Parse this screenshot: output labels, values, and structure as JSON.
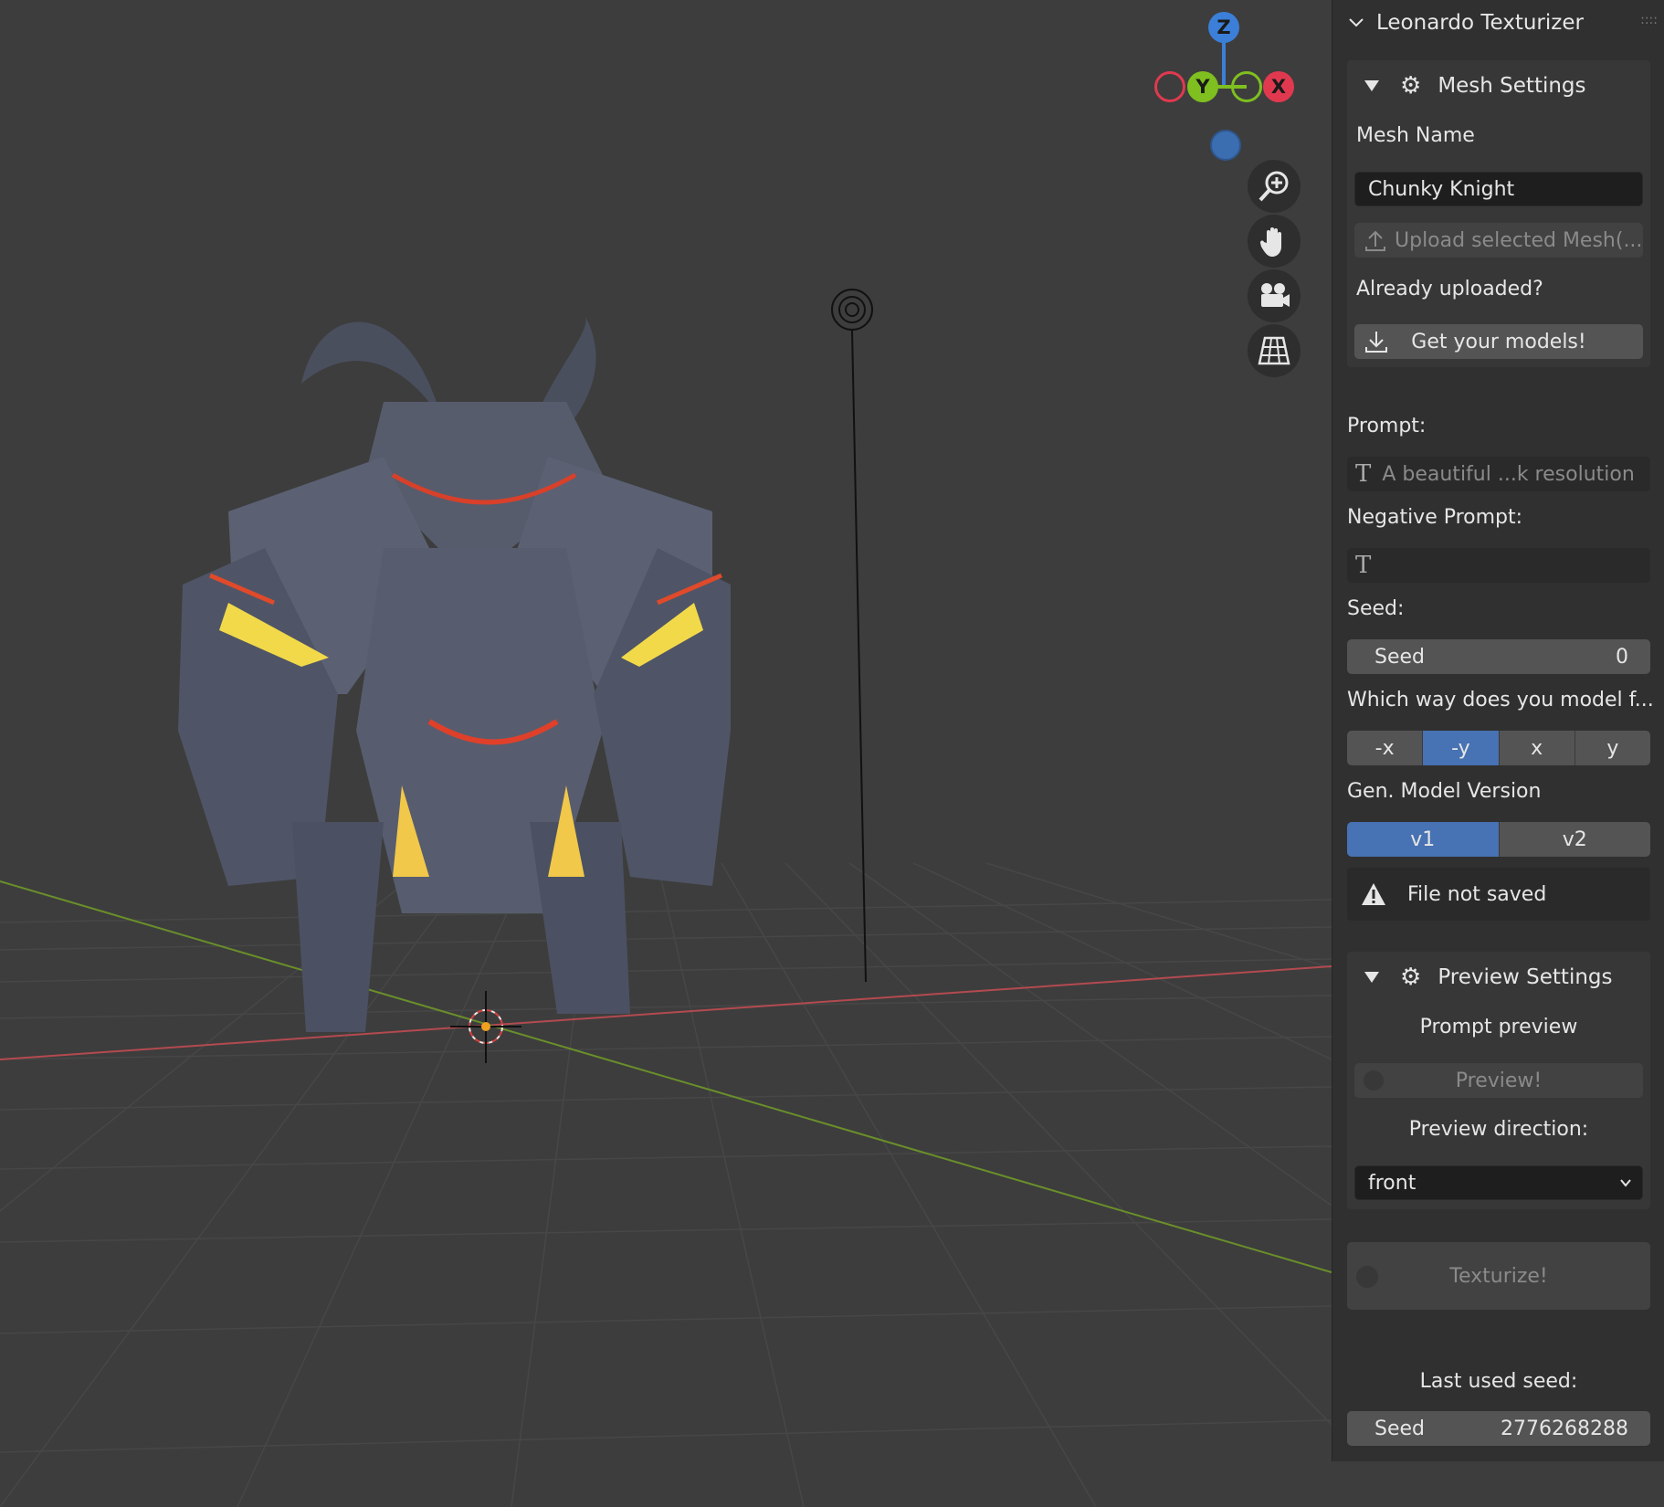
{
  "gizmo": {
    "z": "Z",
    "y": "Y",
    "x": "X"
  },
  "panel": {
    "title": "Leonardo Texturizer",
    "mesh_settings": {
      "title": "Mesh Settings",
      "mesh_name_label": "Mesh Name",
      "mesh_name_value": "Chunky Knight",
      "upload_button": "Upload selected Mesh(...",
      "already_uploaded_label": "Already uploaded?",
      "get_models_button": "Get your models!"
    },
    "prompt_label": "Prompt:",
    "prompt_value": "A beautiful ...k resolution",
    "negative_prompt_label": "Negative Prompt:",
    "negative_prompt_value": "",
    "seed_label": "Seed:",
    "seed_field": {
      "label": "Seed",
      "value": "0"
    },
    "facing_label": "Which way does you model f...",
    "facing_options": [
      "-x",
      "-y",
      "x",
      "y"
    ],
    "facing_selected": "-y",
    "model_version_label": "Gen. Model Version",
    "model_version_options": [
      "v1",
      "v2"
    ],
    "model_version_selected": "v1",
    "warning": "File not saved",
    "preview_settings": {
      "title": "Preview Settings",
      "prompt_preview_label": "Prompt preview",
      "preview_button": "Preview!",
      "preview_direction_label": "Preview direction:",
      "preview_direction_value": "front"
    },
    "texturize_button": "Texturize!",
    "last_seed_label": "Last used seed:",
    "last_seed_field": {
      "label": "Seed",
      "value": "2776268288"
    }
  },
  "colors": {
    "accent": "#4772b3",
    "axis_x": "#e0394f",
    "axis_y": "#7fbf1f",
    "axis_z": "#3b7fd8"
  }
}
